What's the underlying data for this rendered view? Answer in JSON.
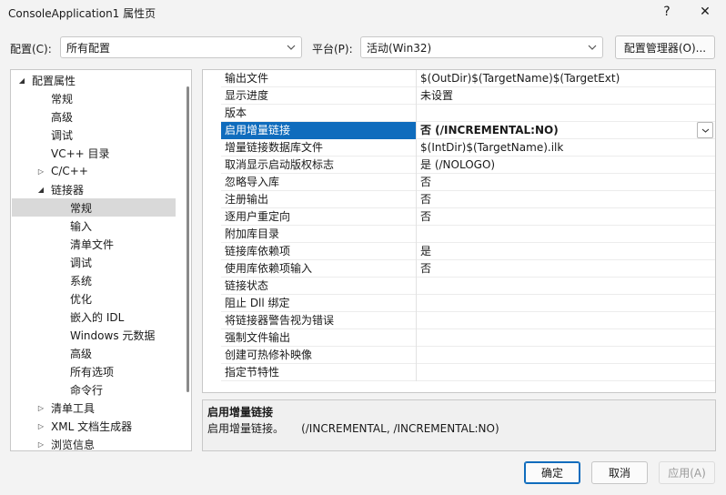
{
  "window": {
    "title": "ConsoleApplication1 属性页",
    "help_glyph": "?",
    "close_glyph": "✕"
  },
  "toolbar": {
    "config_label": "配置(C):",
    "config_value": "所有配置",
    "platform_label": "平台(P):",
    "platform_value": "活动(Win32)",
    "config_manager_label": "配置管理器(O)..."
  },
  "tree": {
    "items": [
      {
        "label": "配置属性",
        "expander": "expanded"
      },
      {
        "label": "常规",
        "expander": "none"
      },
      {
        "label": "高级",
        "expander": "none"
      },
      {
        "label": "调试",
        "expander": "none"
      },
      {
        "label": "VC++ 目录",
        "expander": "none"
      },
      {
        "label": "C/C++",
        "expander": "collapsed"
      },
      {
        "label": "链接器",
        "expander": "expanded"
      },
      {
        "label": "常规",
        "expander": "none",
        "selected": true
      },
      {
        "label": "输入",
        "expander": "none"
      },
      {
        "label": "清单文件",
        "expander": "none"
      },
      {
        "label": "调试",
        "expander": "none"
      },
      {
        "label": "系统",
        "expander": "none"
      },
      {
        "label": "优化",
        "expander": "none"
      },
      {
        "label": "嵌入的 IDL",
        "expander": "none"
      },
      {
        "label": "Windows 元数据",
        "expander": "none"
      },
      {
        "label": "高级",
        "expander": "none"
      },
      {
        "label": "所有选项",
        "expander": "none"
      },
      {
        "label": "命令行",
        "expander": "none"
      },
      {
        "label": "清单工具",
        "expander": "collapsed"
      },
      {
        "label": "XML 文档生成器",
        "expander": "collapsed"
      },
      {
        "label": "浏览信息",
        "expander": "collapsed"
      }
    ]
  },
  "properties": {
    "rows": [
      {
        "name": "输出文件",
        "value": "$(OutDir)$(TargetName)$(TargetExt)"
      },
      {
        "name": "显示进度",
        "value": "未设置"
      },
      {
        "name": "版本",
        "value": ""
      },
      {
        "name": "启用增量链接",
        "value": "否 (/INCREMENTAL:NO)",
        "selected": true
      },
      {
        "name": "增量链接数据库文件",
        "value": "$(IntDir)$(TargetName).ilk"
      },
      {
        "name": "取消显示启动版权标志",
        "value": "是 (/NOLOGO)"
      },
      {
        "name": "忽略导入库",
        "value": "否"
      },
      {
        "name": "注册输出",
        "value": "否"
      },
      {
        "name": "逐用户重定向",
        "value": "否"
      },
      {
        "name": "附加库目录",
        "value": ""
      },
      {
        "name": "链接库依赖项",
        "value": "是"
      },
      {
        "name": "使用库依赖项输入",
        "value": "否"
      },
      {
        "name": "链接状态",
        "value": ""
      },
      {
        "name": "阻止 Dll 绑定",
        "value": ""
      },
      {
        "name": "将链接器警告视为错误",
        "value": ""
      },
      {
        "name": "强制文件输出",
        "value": ""
      },
      {
        "name": "创建可热修补映像",
        "value": ""
      },
      {
        "name": "指定节特性",
        "value": ""
      }
    ]
  },
  "description": {
    "title": "启用增量链接",
    "text": "启用增量链接。     (/INCREMENTAL, /INCREMENTAL:NO)"
  },
  "buttons": {
    "ok": "确定",
    "cancel": "取消",
    "apply": "应用(A)"
  },
  "colors": {
    "selection_blue": "#0f6cbd",
    "tree_selection": "#d9d9d9"
  }
}
